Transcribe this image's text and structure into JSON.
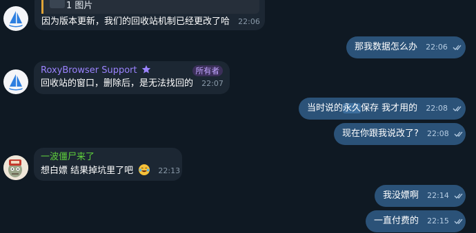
{
  "chat": {
    "colors": {
      "background": "#0f1923",
      "incoming_bubble": "#1c2733",
      "outgoing_bubble": "#2b5278",
      "sender_roxy": "#9b83ff",
      "sender_zombie": "#5fd03c"
    },
    "messages": [
      {
        "direction": "in",
        "quote": "1 图片",
        "text": "因为版本更新，我们的回收站机制已经更改了哈",
        "time": "22:06",
        "avatar": "sailboat-logo"
      },
      {
        "direction": "out",
        "text": "那我数据怎么办",
        "time": "22:06",
        "read": true
      },
      {
        "direction": "in",
        "sender": "RoxyBrowser Support",
        "sender_icon": "star-icon",
        "badge": "所有者",
        "text": "回收站的窗口，删除后，是无法找回的",
        "time": "22:07",
        "avatar": "sailboat-logo"
      },
      {
        "direction": "out",
        "text_before": "当时说的",
        "text_highlight": "永久",
        "text_after": "保存 我才用的",
        "time": "22:08",
        "read": true
      },
      {
        "direction": "out",
        "text": "现在你跟我说改了?",
        "time": "22:08",
        "read": true
      },
      {
        "direction": "in",
        "sender": "一波僵尸来了",
        "text": "想白嫖 结果掉坑里了吧",
        "emoji": "laughing-tears-emoji",
        "time": "22:13",
        "avatar": "zombie-avatar"
      },
      {
        "direction": "out",
        "text": "我没嫖啊",
        "time": "22:14",
        "read": true
      },
      {
        "direction": "out",
        "text": "一直付费的",
        "time": "22:15",
        "read": true
      }
    ]
  }
}
